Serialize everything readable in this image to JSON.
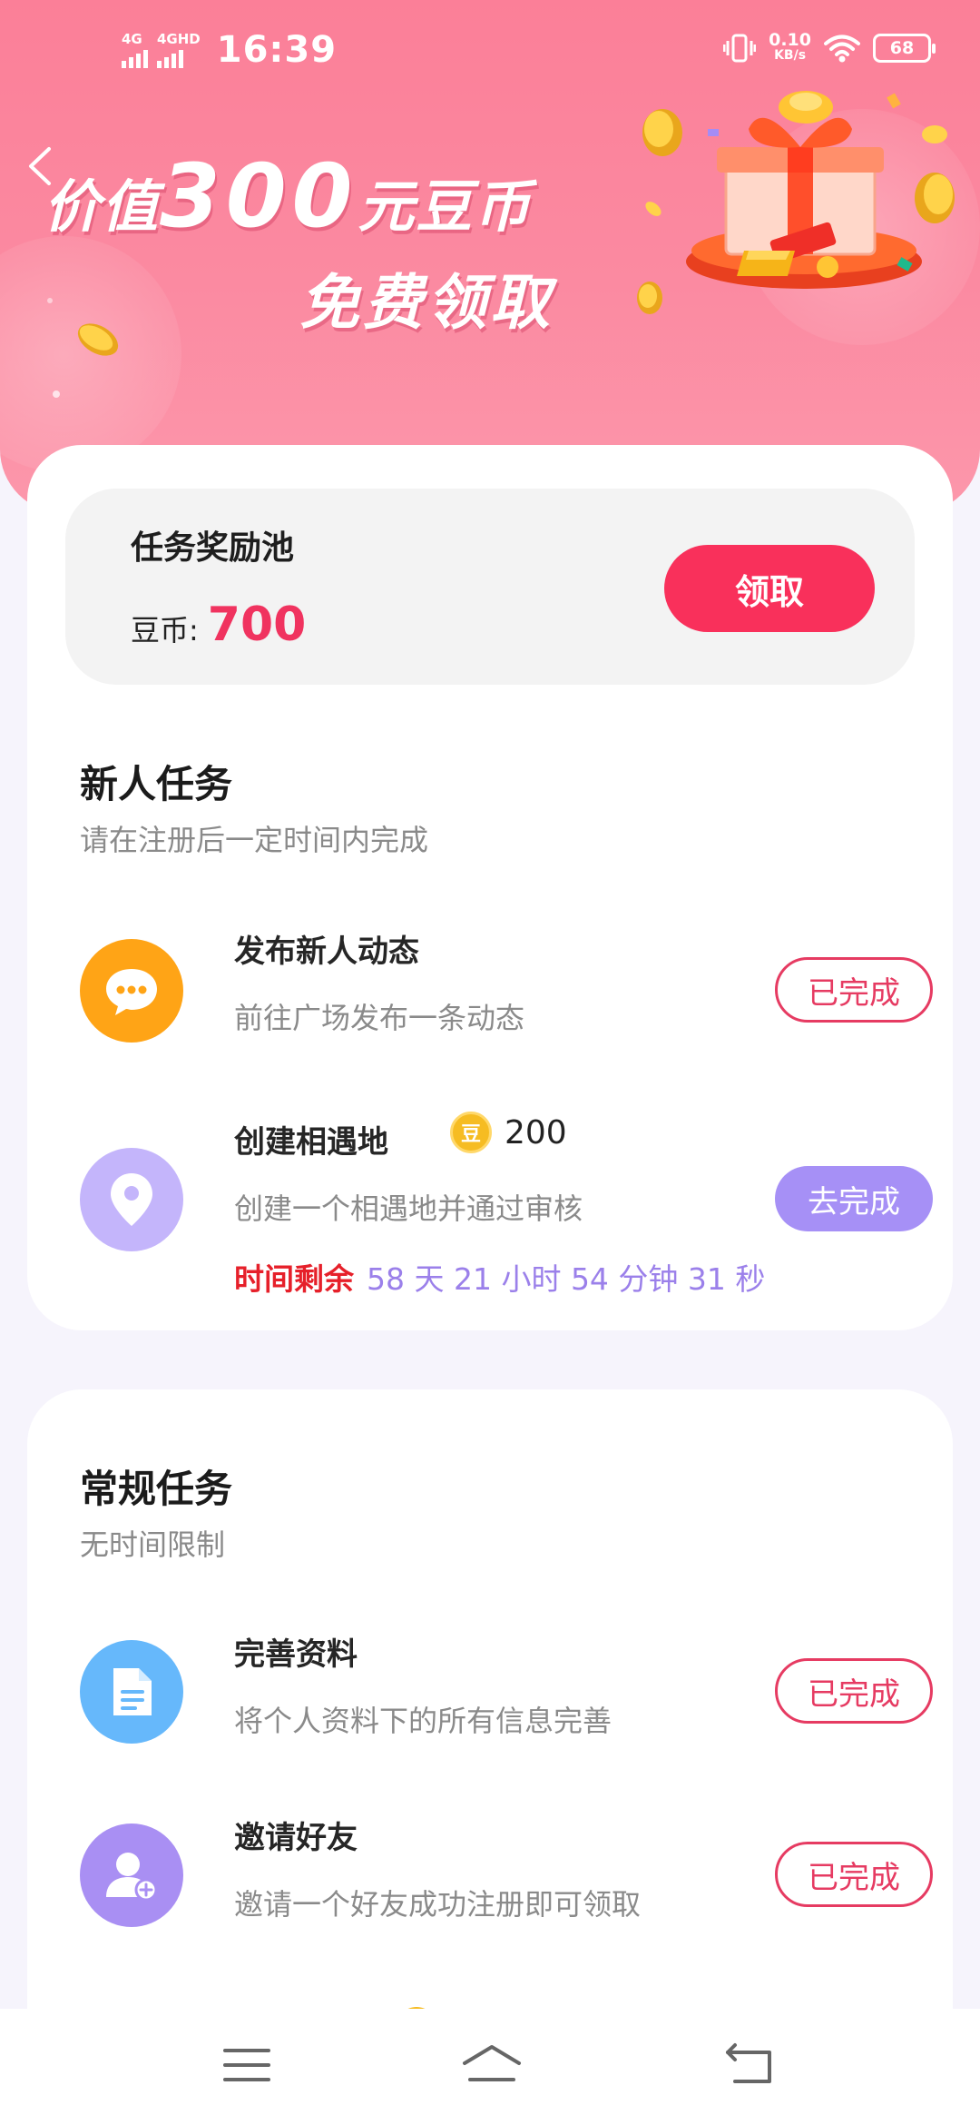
{
  "status_bar": {
    "net1": "4G",
    "net2": "4GHD",
    "time": "16:39",
    "speed_value": "0.10",
    "speed_unit": "KB/s",
    "battery": "68"
  },
  "hero": {
    "line1_prefix": "价值",
    "line1_amount": "300",
    "line1_suffix": "元豆币",
    "line2": "免费领取"
  },
  "pool": {
    "title": "任务奖励池",
    "coin_label": "豆币:",
    "coin_value": "700",
    "claim_label": "领取"
  },
  "newbie": {
    "title": "新人任务",
    "subtitle": "请在注册后一定时间内完成",
    "tasks": [
      {
        "name": "发布新人动态",
        "desc": "前往广场发布一条动态",
        "button": "已完成",
        "icon": "chat-bubble-icon",
        "icon_color": "#ffa416"
      },
      {
        "name": "创建相遇地",
        "reward_icon_text": "豆",
        "reward": "200",
        "desc": "创建一个相遇地并通过审核",
        "button": "去完成",
        "icon": "location-pin-icon",
        "icon_color": "#c4b5fb",
        "countdown_label": "时间剩余",
        "countdown_value": "58 天 21 小时 54 分钟 31 秒"
      }
    ]
  },
  "regular": {
    "title": "常规任务",
    "subtitle": "无时间限制",
    "tasks": [
      {
        "name": "完善资料",
        "desc": "将个人资料下的所有信息完善",
        "button": "已完成",
        "icon": "document-icon",
        "icon_color": "#66b8fb"
      },
      {
        "name": "邀请好友",
        "desc": "邀请一个好友成功注册即可领取",
        "button": "已完成",
        "icon": "add-user-icon",
        "icon_color": "#a98ff3"
      }
    ]
  },
  "colors": {
    "accent": "#f9305b",
    "hero_pink": "#fb8aa1",
    "countdown_red": "#e6202a",
    "countdown_purple": "#9b80ea"
  }
}
